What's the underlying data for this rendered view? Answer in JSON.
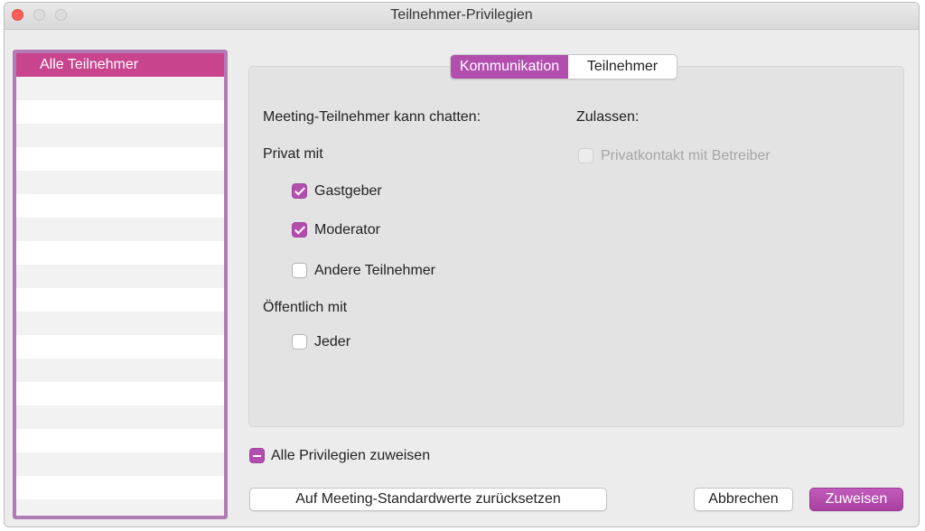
{
  "window": {
    "title": "Teilnehmer-Privilegien"
  },
  "sidebar": {
    "items": [
      {
        "label": "Alle Teilnehmer",
        "selected": true
      }
    ]
  },
  "tabs": [
    {
      "label": "Kommunikation",
      "active": true
    },
    {
      "label": "Teilnehmer",
      "active": false
    }
  ],
  "chat": {
    "heading": "Meeting-Teilnehmer kann chatten:",
    "private_heading": "Privat mit",
    "private_options": [
      {
        "label": "Gastgeber",
        "checked": true
      },
      {
        "label": "Moderator",
        "checked": true
      },
      {
        "label": "Andere Teilnehmer",
        "checked": false
      }
    ],
    "public_heading": "Öffentlich mit",
    "public_options": [
      {
        "label": "Jeder",
        "checked": false
      }
    ]
  },
  "allow": {
    "heading": "Zulassen:",
    "options": [
      {
        "label": "Privatkontakt mit Betreiber",
        "checked": false,
        "enabled": false
      }
    ]
  },
  "assign_all": {
    "label": "Alle Privilegien zuweisen",
    "state": "mixed"
  },
  "buttons": {
    "reset": "Auf Meeting-Standardwerte zurücksetzen",
    "cancel": "Abbrechen",
    "assign": "Zuweisen"
  },
  "colors": {
    "accent": "#b24fae",
    "selection": "#c8458e",
    "close": "#fc5f57"
  }
}
